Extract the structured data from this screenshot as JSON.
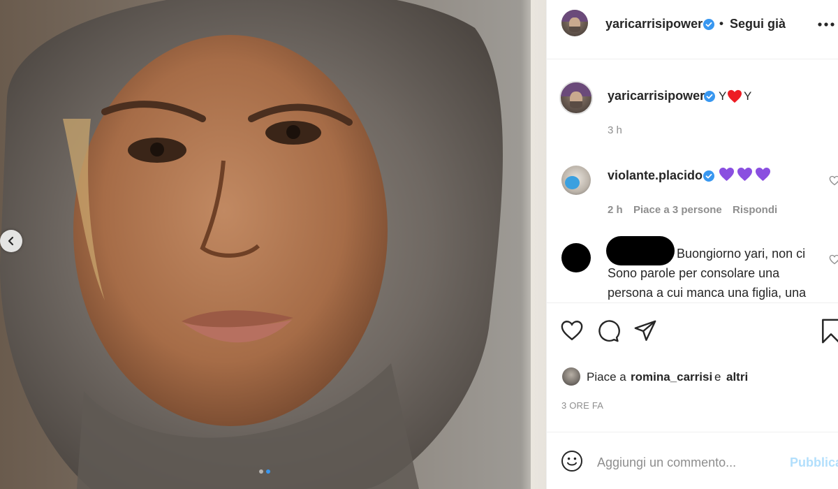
{
  "post": {
    "author": "yaricarrisipower",
    "follow_separator": "•",
    "follow_status": "Segui già",
    "more_icon": "more-horizontal-icon"
  },
  "caption": {
    "author": "yaricarrisipower",
    "text_before": "Y",
    "text_after": "Y",
    "time": "3 h"
  },
  "comments": [
    {
      "author": "violante.placido",
      "hearts": 3,
      "heart_color": "#8a4fe0",
      "time": "2 h",
      "likes": "Piace a 3 persone",
      "reply": "Rispondi"
    },
    {
      "author": "",
      "line1": "Buongiorno yari, non ci",
      "line2": "Sono parole per consolare una",
      "line3": "persona a cui manca una figlia, una"
    }
  ],
  "likes": {
    "prefix": "Piace a",
    "user": "romina_carrisi",
    "joiner": "e",
    "others": "altri"
  },
  "timestamp": "3 ORE FA",
  "add_comment": {
    "placeholder": "Aggiungi un commento...",
    "publish": "Pubblica"
  },
  "carousel": {
    "count": 2,
    "active": 1
  },
  "colors": {
    "verified": "#3897f0",
    "red_heart": "#ed1c24",
    "publish": "#b2dffc",
    "muted": "#8e8e8e"
  }
}
